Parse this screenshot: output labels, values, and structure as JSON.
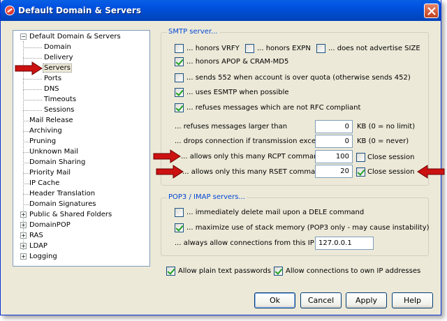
{
  "window": {
    "title": "Default Domain & Servers",
    "accent_color": "#0054e3",
    "icons": {
      "title": "app-icon",
      "close": "close-icon"
    }
  },
  "tree": {
    "items": [
      {
        "label": "Default Domain & Servers",
        "level": 0,
        "expander": "-"
      },
      {
        "label": "Domain",
        "level": 1
      },
      {
        "label": "Delivery",
        "level": 1
      },
      {
        "label": "Servers",
        "level": 1,
        "selected": true
      },
      {
        "label": "Ports",
        "level": 1
      },
      {
        "label": "DNS",
        "level": 1
      },
      {
        "label": "Timeouts",
        "level": 1
      },
      {
        "label": "Sessions",
        "level": 1
      },
      {
        "label": "Mail Release",
        "level": 0
      },
      {
        "label": "Archiving",
        "level": 0
      },
      {
        "label": "Pruning",
        "level": 0
      },
      {
        "label": "Unknown Mail",
        "level": 0
      },
      {
        "label": "Domain Sharing",
        "level": 0
      },
      {
        "label": "Priority Mail",
        "level": 0
      },
      {
        "label": "IP Cache",
        "level": 0
      },
      {
        "label": "Header Translation",
        "level": 0
      },
      {
        "label": "Domain Signatures",
        "level": 0
      },
      {
        "label": "Public & Shared Folders",
        "level": 0,
        "expander": "+"
      },
      {
        "label": "DomainPOP",
        "level": 0,
        "expander": "+"
      },
      {
        "label": "RAS",
        "level": 0,
        "expander": "+"
      },
      {
        "label": "LDAP",
        "level": 0,
        "expander": "+"
      },
      {
        "label": "Logging",
        "level": 0,
        "expander": "+"
      }
    ]
  },
  "smtp": {
    "group_label": "SMTP server...",
    "vrfy": {
      "label": "... honors VRFY",
      "checked": false
    },
    "expn": {
      "label": "... honors EXPN",
      "checked": false
    },
    "size": {
      "label": "... does not advertise SIZE",
      "checked": false
    },
    "apop": {
      "label": "... honors APOP & CRAM-MD5",
      "checked": true
    },
    "send552": {
      "label": "... sends 552 when account is over quota (otherwise sends 452)",
      "checked": false
    },
    "esmtp": {
      "label": "... uses ESMTP when possible",
      "checked": true
    },
    "rfc": {
      "label": "... refuses messages which are not RFC compliant",
      "checked": true
    },
    "max_size": {
      "label": "... refuses messages larger than",
      "value": "0",
      "unit": "KB (0 = no limit)"
    },
    "drop_conn": {
      "label": "... drops connection if transmission exceeds",
      "value": "0",
      "unit": "KB (0 = never)"
    },
    "rcpt": {
      "label": "... allows only this many RCPT commands",
      "value": "100",
      "close_label": "Close session",
      "close_checked": false
    },
    "rset": {
      "label": "... allows only this many RSET commands",
      "value": "20",
      "close_label": "Close session",
      "close_checked": true
    }
  },
  "pop": {
    "group_label": "POP3 / IMAP servers...",
    "dele": {
      "label": "... immediately delete mail upon a DELE command",
      "checked": false
    },
    "stack": {
      "label": "... maximize use of stack memory (POP3 only - may cause instability)",
      "checked": true
    },
    "allow_ip": {
      "label": "... always allow connections from this IP",
      "value": "127.0.0.1"
    }
  },
  "bottom": {
    "plain_text": {
      "label": "Allow plain text passwords",
      "checked": true
    },
    "own_ip": {
      "label": "Allow connections to own IP addresses",
      "checked": true
    }
  },
  "buttons": {
    "ok": "Ok",
    "cancel": "Cancel",
    "apply": "Apply",
    "help": "Help"
  },
  "annotations": {
    "arrow_color": "#cc1111",
    "icon": "red-arrow-icon"
  }
}
